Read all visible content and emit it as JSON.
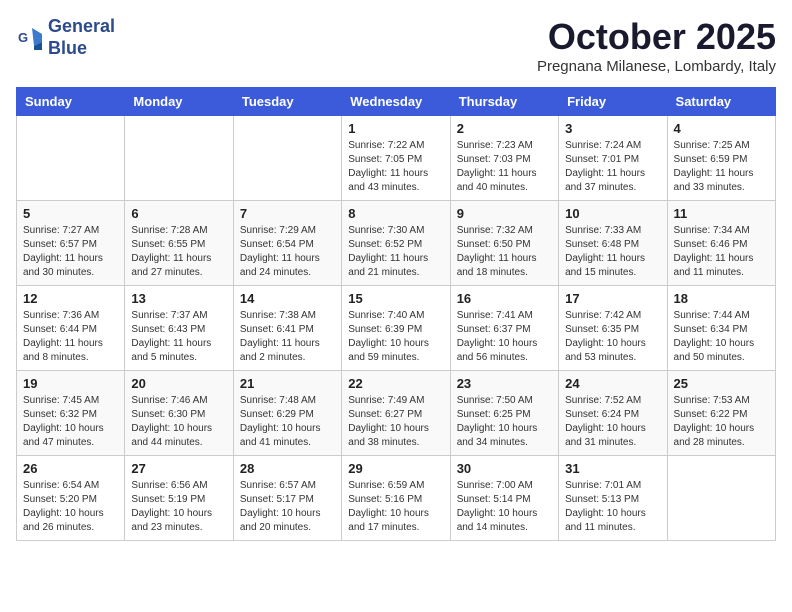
{
  "header": {
    "logo_line1": "General",
    "logo_line2": "Blue",
    "month": "October 2025",
    "location": "Pregnana Milanese, Lombardy, Italy"
  },
  "days_of_week": [
    "Sunday",
    "Monday",
    "Tuesday",
    "Wednesday",
    "Thursday",
    "Friday",
    "Saturday"
  ],
  "weeks": [
    [
      {
        "day": "",
        "info": ""
      },
      {
        "day": "",
        "info": ""
      },
      {
        "day": "",
        "info": ""
      },
      {
        "day": "1",
        "info": "Sunrise: 7:22 AM\nSunset: 7:05 PM\nDaylight: 11 hours and 43 minutes."
      },
      {
        "day": "2",
        "info": "Sunrise: 7:23 AM\nSunset: 7:03 PM\nDaylight: 11 hours and 40 minutes."
      },
      {
        "day": "3",
        "info": "Sunrise: 7:24 AM\nSunset: 7:01 PM\nDaylight: 11 hours and 37 minutes."
      },
      {
        "day": "4",
        "info": "Sunrise: 7:25 AM\nSunset: 6:59 PM\nDaylight: 11 hours and 33 minutes."
      }
    ],
    [
      {
        "day": "5",
        "info": "Sunrise: 7:27 AM\nSunset: 6:57 PM\nDaylight: 11 hours and 30 minutes."
      },
      {
        "day": "6",
        "info": "Sunrise: 7:28 AM\nSunset: 6:55 PM\nDaylight: 11 hours and 27 minutes."
      },
      {
        "day": "7",
        "info": "Sunrise: 7:29 AM\nSunset: 6:54 PM\nDaylight: 11 hours and 24 minutes."
      },
      {
        "day": "8",
        "info": "Sunrise: 7:30 AM\nSunset: 6:52 PM\nDaylight: 11 hours and 21 minutes."
      },
      {
        "day": "9",
        "info": "Sunrise: 7:32 AM\nSunset: 6:50 PM\nDaylight: 11 hours and 18 minutes."
      },
      {
        "day": "10",
        "info": "Sunrise: 7:33 AM\nSunset: 6:48 PM\nDaylight: 11 hours and 15 minutes."
      },
      {
        "day": "11",
        "info": "Sunrise: 7:34 AM\nSunset: 6:46 PM\nDaylight: 11 hours and 11 minutes."
      }
    ],
    [
      {
        "day": "12",
        "info": "Sunrise: 7:36 AM\nSunset: 6:44 PM\nDaylight: 11 hours and 8 minutes."
      },
      {
        "day": "13",
        "info": "Sunrise: 7:37 AM\nSunset: 6:43 PM\nDaylight: 11 hours and 5 minutes."
      },
      {
        "day": "14",
        "info": "Sunrise: 7:38 AM\nSunset: 6:41 PM\nDaylight: 11 hours and 2 minutes."
      },
      {
        "day": "15",
        "info": "Sunrise: 7:40 AM\nSunset: 6:39 PM\nDaylight: 10 hours and 59 minutes."
      },
      {
        "day": "16",
        "info": "Sunrise: 7:41 AM\nSunset: 6:37 PM\nDaylight: 10 hours and 56 minutes."
      },
      {
        "day": "17",
        "info": "Sunrise: 7:42 AM\nSunset: 6:35 PM\nDaylight: 10 hours and 53 minutes."
      },
      {
        "day": "18",
        "info": "Sunrise: 7:44 AM\nSunset: 6:34 PM\nDaylight: 10 hours and 50 minutes."
      }
    ],
    [
      {
        "day": "19",
        "info": "Sunrise: 7:45 AM\nSunset: 6:32 PM\nDaylight: 10 hours and 47 minutes."
      },
      {
        "day": "20",
        "info": "Sunrise: 7:46 AM\nSunset: 6:30 PM\nDaylight: 10 hours and 44 minutes."
      },
      {
        "day": "21",
        "info": "Sunrise: 7:48 AM\nSunset: 6:29 PM\nDaylight: 10 hours and 41 minutes."
      },
      {
        "day": "22",
        "info": "Sunrise: 7:49 AM\nSunset: 6:27 PM\nDaylight: 10 hours and 38 minutes."
      },
      {
        "day": "23",
        "info": "Sunrise: 7:50 AM\nSunset: 6:25 PM\nDaylight: 10 hours and 34 minutes."
      },
      {
        "day": "24",
        "info": "Sunrise: 7:52 AM\nSunset: 6:24 PM\nDaylight: 10 hours and 31 minutes."
      },
      {
        "day": "25",
        "info": "Sunrise: 7:53 AM\nSunset: 6:22 PM\nDaylight: 10 hours and 28 minutes."
      }
    ],
    [
      {
        "day": "26",
        "info": "Sunrise: 6:54 AM\nSunset: 5:20 PM\nDaylight: 10 hours and 26 minutes."
      },
      {
        "day": "27",
        "info": "Sunrise: 6:56 AM\nSunset: 5:19 PM\nDaylight: 10 hours and 23 minutes."
      },
      {
        "day": "28",
        "info": "Sunrise: 6:57 AM\nSunset: 5:17 PM\nDaylight: 10 hours and 20 minutes."
      },
      {
        "day": "29",
        "info": "Sunrise: 6:59 AM\nSunset: 5:16 PM\nDaylight: 10 hours and 17 minutes."
      },
      {
        "day": "30",
        "info": "Sunrise: 7:00 AM\nSunset: 5:14 PM\nDaylight: 10 hours and 14 minutes."
      },
      {
        "day": "31",
        "info": "Sunrise: 7:01 AM\nSunset: 5:13 PM\nDaylight: 10 hours and 11 minutes."
      },
      {
        "day": "",
        "info": ""
      }
    ]
  ]
}
